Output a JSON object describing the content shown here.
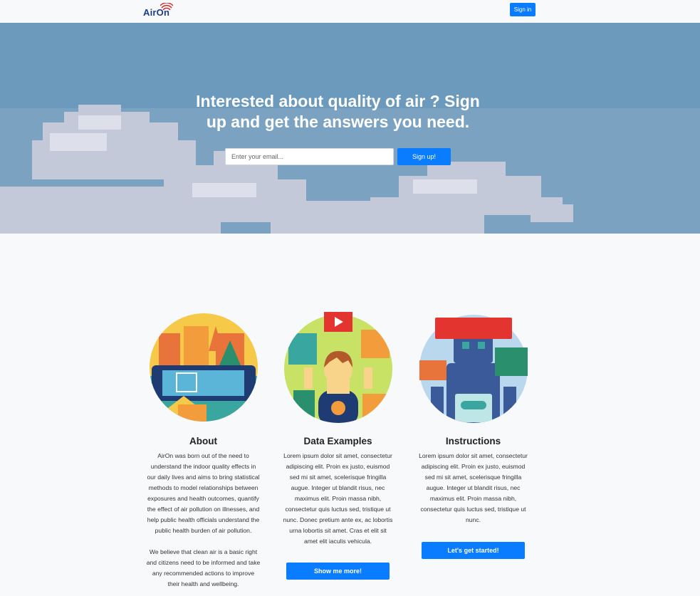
{
  "navbar": {
    "logo_text": "AirOn",
    "signin_label": "Sign in"
  },
  "hero": {
    "title": "Interested about quality of air ? Sign up and get the answers you need.",
    "email_placeholder": "Enter your email...",
    "signup_label": "Sign up!"
  },
  "features": [
    {
      "title": "About",
      "body": "AirOn was born out of the need to understand the indoor quality effects in our daily lives and aims to bring statistical methods to model relationships between exposures and health outcomes, quantify the effect of air pollution on illnesses, and help public health officials understand the public health burden of air pollution.",
      "body2": "We believe that clean air is a basic right and citizens need to be informed and take any recommended actions to improve their health and wellbeing.",
      "icon": "city-icon"
    },
    {
      "title": "Data Examples",
      "body": "Lorem ipsum dolor sit amet, consectetur adipiscing elit. Proin ex justo, euismod sed mi sit amet, scelerisque fringilla augue. Integer ut blandit risus, nec maximus elit. Proin massa nibh, consectetur quis luctus sed, tristique ut nunc. Donec pretium ante ex, ac lobortis urna lobortis sit amet. Cras et elit sit amet elit iaculis vehicula.",
      "button": "Show me more!",
      "icon": "person-data-icon"
    },
    {
      "title": "Instructions",
      "body": "Lorem ipsum dolor sit amet, consectetur adipiscing elit. Proin ex justo, euismod sed mi sit amet, scelerisque fringilla augue. Integer ut blandit risus, nec maximus elit. Proin massa nibh, consectetur quis luctus sed, tristique ut nunc.",
      "button": "Let's get started!",
      "icon": "robot-icon"
    }
  ],
  "colors": {
    "accent": "#0a7cff",
    "hero_sky": "#6b9abd",
    "background": "#f7f9fb"
  }
}
